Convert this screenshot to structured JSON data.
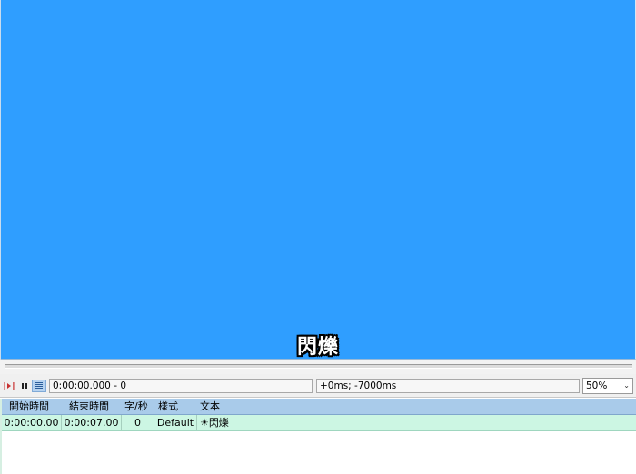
{
  "video": {
    "background": "#2f9eff",
    "subtitle_preview": "閃爍"
  },
  "toolbar": {
    "play_line_icon": "play-line-icon",
    "pause_icon": "pause-icon",
    "autoscroll_icon": "autoscroll-icon",
    "time_value": "0:00:00.000 - 0",
    "offset_value": "+0ms; -7000ms",
    "zoom_value": "50%"
  },
  "grid": {
    "columns": [
      "開始時間",
      "結束時間",
      "字/秒",
      "樣式",
      "文本"
    ],
    "rows": [
      {
        "start": "0:00:00.00",
        "end": "0:00:07.00",
        "cps": "0",
        "style": "Default",
        "text": "☀閃爍"
      }
    ],
    "selected_row_color": "#ccf6e3",
    "header_color": "#a9cbea"
  }
}
